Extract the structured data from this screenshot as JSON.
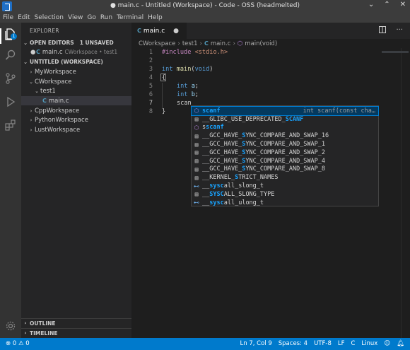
{
  "window": {
    "title": "● main.c - Untitled (Workspace) - Code - OSS (headmelted)",
    "minimize": "⌄",
    "restore": "⌃",
    "close": "✕"
  },
  "menu": [
    "File",
    "Edit",
    "Selection",
    "View",
    "Go",
    "Run",
    "Terminal",
    "Help"
  ],
  "activity": {
    "explorer_badge": "1",
    "icons": [
      "files-icon",
      "search-icon",
      "source-control-icon",
      "run-debug-icon",
      "extensions-icon"
    ]
  },
  "sidebar": {
    "title": "EXPLORER",
    "open_editors": {
      "label": "OPEN EDITORS",
      "unsaved": "1 UNSAVED",
      "items": [
        {
          "lang": "C",
          "name": "main.c",
          "path": "CWorkspace • test1"
        }
      ]
    },
    "workspace": {
      "label": "UNTITLED (WORKSPACE)",
      "items": [
        {
          "name": "MyWorkspace",
          "expanded": false
        },
        {
          "name": "CWorkspace",
          "expanded": true
        },
        {
          "name": "test1",
          "expanded": true
        },
        {
          "name": "main.c",
          "lang": "C"
        },
        {
          "name": "CppWorkspace",
          "expanded": false
        },
        {
          "name": "PythonWorkspace",
          "expanded": false
        },
        {
          "name": "LustWorkspace",
          "expanded": false
        }
      ]
    },
    "outline": "OUTLINE",
    "timeline": "TIMELINE"
  },
  "editor": {
    "tab": {
      "lang": "C",
      "name": "main.c",
      "dirty": "●"
    },
    "breadcrumb": [
      "CWorkspace",
      "test1",
      "main.c",
      "main(void)"
    ],
    "breadcrumb_c": "C",
    "lines": [
      "1",
      "2",
      "3",
      "4",
      "5",
      "6",
      "7",
      "8"
    ],
    "code": {
      "l1_directive": "#include",
      "l1_header": " <stdio.h>",
      "l3_type": "int",
      "l3_fn": " main",
      "l3_rest": "(",
      "l3_void": "void",
      "l3_close": ")",
      "l4": "{",
      "l6_type": "int",
      "l6_var": " a",
      "l6_end": ";",
      "l7_type": "int",
      "l7_var": " b",
      "l7_end": ";",
      "l8": "scan",
      "l9": "}"
    }
  },
  "suggest": {
    "items": [
      {
        "icon": "method",
        "pre": "",
        "hl": "scanf",
        "post": "",
        "detail": "int scanf(const cha…"
      },
      {
        "icon": "keyword",
        "pre": "__GLIBC_USE_DEPRECATED_",
        "hl": "SCANF",
        "post": ""
      },
      {
        "icon": "method",
        "pre": "s",
        "hl": "scanf",
        "post": ""
      },
      {
        "icon": "keyword",
        "pre": "__GCC_HAVE_",
        "hl": "S",
        "post": "YNC_COMPARE_AND_SWAP_16"
      },
      {
        "icon": "keyword",
        "pre": "__GCC_HAVE_",
        "hl": "S",
        "post": "YNC_COMPARE_AND_SWAP_1"
      },
      {
        "icon": "keyword",
        "pre": "__GCC_HAVE_",
        "hl": "S",
        "post": "YNC_COMPARE_AND_SWAP_2"
      },
      {
        "icon": "keyword",
        "pre": "__GCC_HAVE_",
        "hl": "S",
        "post": "YNC_COMPARE_AND_SWAP_4"
      },
      {
        "icon": "keyword",
        "pre": "__GCC_HAVE_",
        "hl": "S",
        "post": "YNC_COMPARE_AND_SWAP_8"
      },
      {
        "icon": "keyword",
        "pre": "__KERNEL_",
        "hl": "S",
        "post": "TRICT_NAMES"
      },
      {
        "icon": "field",
        "pre": "__",
        "hl": "sysc",
        "post": "all_slong_t"
      },
      {
        "icon": "keyword",
        "pre": "__",
        "hl": "SYSC",
        "post": "ALL_SLONG_TYPE"
      },
      {
        "icon": "field",
        "pre": "__",
        "hl": "sysc",
        "post": "all_ulong_t"
      }
    ]
  },
  "status": {
    "errors": "⊗ 0",
    "warnings": "⚠ 0",
    "position": "Ln 7, Col 9",
    "spaces": "Spaces: 4",
    "encoding": "UTF-8",
    "eol": "LF",
    "language": "C",
    "os": "Linux",
    "accent": "#007acc"
  }
}
